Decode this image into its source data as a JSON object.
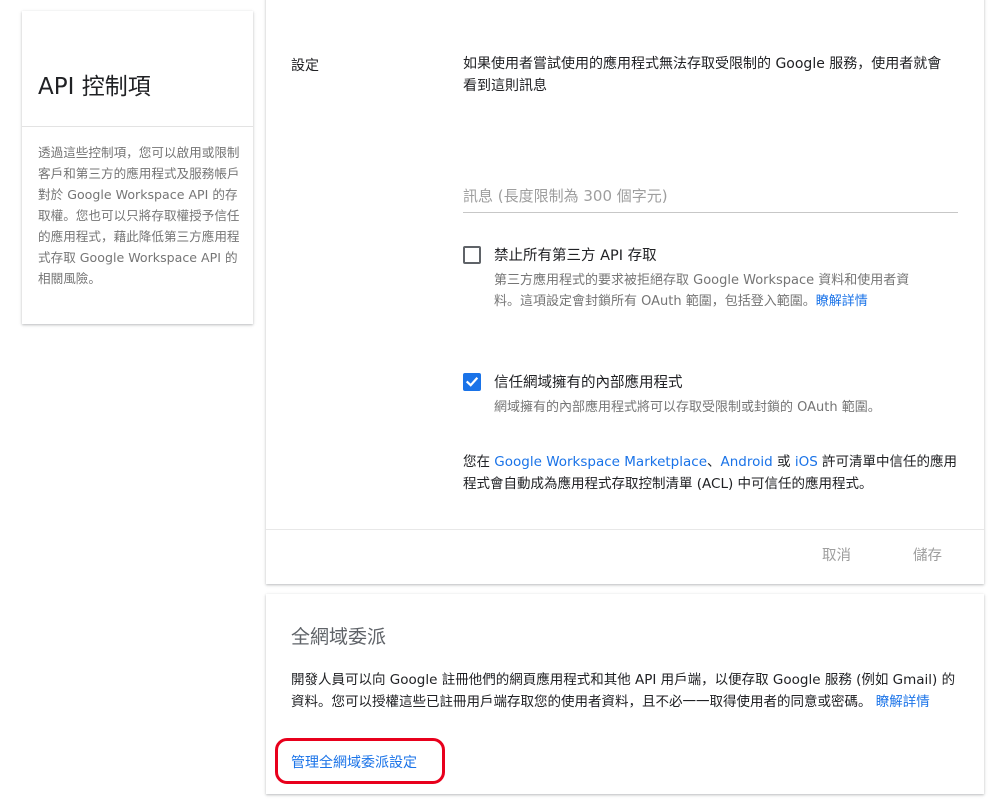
{
  "sidebar": {
    "title": "API 控制項",
    "description": "透過這些控制項，您可以啟用或限制客戶和第三方的應用程式及服務帳戶對於 Google Workspace API 的存取權。您也可以只將存取權授予信任的應用程式，藉此降低第三方應用程式存取 Google Workspace API 的相關風險。"
  },
  "settings": {
    "label": "設定",
    "intro": "如果使用者嘗試使用的應用程式無法存取受限制的 Google 服務，使用者就會看到這則訊息",
    "message_value": "",
    "message_placeholder": "訊息 (長度限制為 300 個字元)",
    "block_all": {
      "label": "禁止所有第三方 API 存取",
      "checked": false,
      "desc": "第三方應用程式的要求被拒絕存取 Google Workspace 資料和使用者資料。這項設定會封鎖所有 OAuth 範圍，包括登入範圍。",
      "learn_more": "瞭解詳情"
    },
    "trust_internal": {
      "label": "信任網域擁有的內部應用程式",
      "checked": true,
      "desc": "網域擁有的內部應用程式將可以存取受限制或封鎖的 OAuth 範圍。"
    },
    "trust_note": {
      "prefix": "您在 ",
      "link1": "Google Workspace Marketplace",
      "sep1": "、",
      "link2": "Android",
      "sep2": " 或 ",
      "link3": "iOS",
      "suffix": " 許可清單中信任的應用程式會自動成為應用程式存取控制清單 (ACL) 中可信任的應用程式。"
    },
    "cancel_label": "取消",
    "save_label": "儲存"
  },
  "delegation": {
    "title": "全網域委派",
    "desc": "開發人員可以向 Google 註冊他們的網頁應用程式和其他 API 用戶端，以便存取 Google 服務 (例如 Gmail) 的資料。您可以授權這些已註冊用戶端存取您的使用者資料，且不必一一取得使用者的同意或密碼。",
    "learn_more": "瞭解詳情",
    "manage_link": "管理全網域委派設定"
  },
  "colors": {
    "accent": "#1a73e8",
    "highlight": "#e8001c"
  }
}
